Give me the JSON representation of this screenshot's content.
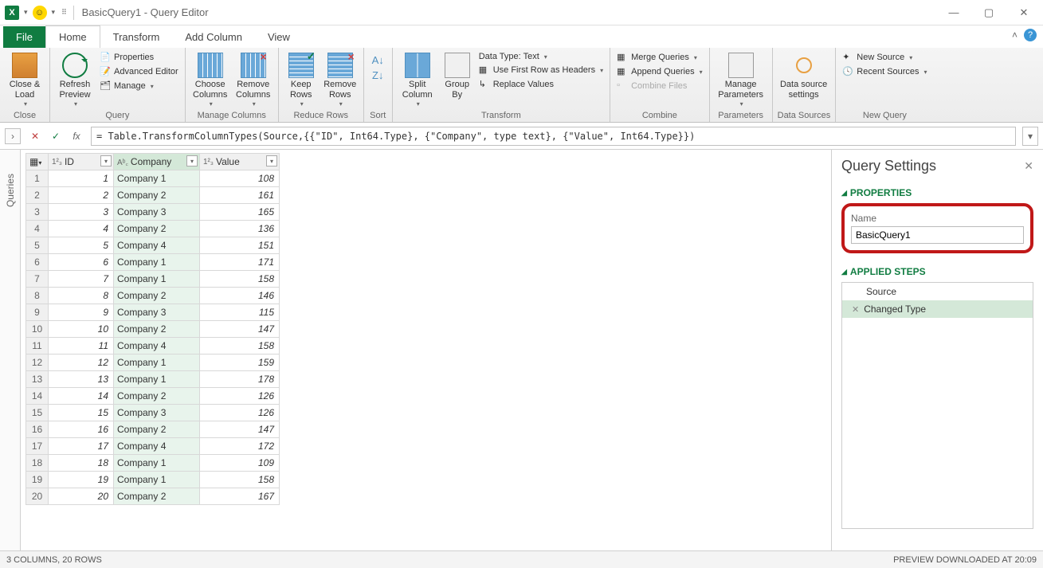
{
  "window": {
    "title": "BasicQuery1 - Query Editor"
  },
  "tabs": {
    "file": "File",
    "home": "Home",
    "transform": "Transform",
    "addcolumn": "Add Column",
    "view": "View"
  },
  "ribbon": {
    "close": {
      "big": "Close & Load",
      "group": "Close"
    },
    "query": {
      "refresh": "Refresh Preview",
      "properties": "Properties",
      "advanced": "Advanced Editor",
      "manage": "Manage",
      "group": "Query"
    },
    "managecols": {
      "choose": "Choose Columns",
      "remove": "Remove Columns",
      "group": "Manage Columns"
    },
    "reducerows": {
      "keep": "Keep Rows",
      "remove": "Remove Rows",
      "group": "Reduce Rows"
    },
    "sort": {
      "group": "Sort"
    },
    "transform": {
      "split": "Split Column",
      "groupby": "Group By",
      "datatype": "Data Type: Text",
      "firstrow": "Use First Row as Headers",
      "replace": "Replace Values",
      "group": "Transform"
    },
    "combine": {
      "merge": "Merge Queries",
      "append": "Append Queries",
      "files": "Combine Files",
      "group": "Combine"
    },
    "params": {
      "manage": "Manage Parameters",
      "group": "Parameters"
    },
    "datasrc": {
      "settings": "Data source settings",
      "group": "Data Sources"
    },
    "newquery": {
      "new": "New Source",
      "recent": "Recent Sources",
      "group": "New Query"
    }
  },
  "formula": "= Table.TransformColumnTypes(Source,{{\"ID\", Int64.Type}, {\"Company\", type text}, {\"Value\", Int64.Type}})",
  "queries_label": "Queries",
  "columns": {
    "id": "ID",
    "company": "Company",
    "value": "Value"
  },
  "rows": [
    {
      "n": 1,
      "id": 1,
      "company": "Company 1",
      "value": 108
    },
    {
      "n": 2,
      "id": 2,
      "company": "Company 2",
      "value": 161
    },
    {
      "n": 3,
      "id": 3,
      "company": "Company 3",
      "value": 165
    },
    {
      "n": 4,
      "id": 4,
      "company": "Company 2",
      "value": 136
    },
    {
      "n": 5,
      "id": 5,
      "company": "Company 4",
      "value": 151
    },
    {
      "n": 6,
      "id": 6,
      "company": "Company 1",
      "value": 171
    },
    {
      "n": 7,
      "id": 7,
      "company": "Company 1",
      "value": 158
    },
    {
      "n": 8,
      "id": 8,
      "company": "Company 2",
      "value": 146
    },
    {
      "n": 9,
      "id": 9,
      "company": "Company 3",
      "value": 115
    },
    {
      "n": 10,
      "id": 10,
      "company": "Company 2",
      "value": 147
    },
    {
      "n": 11,
      "id": 11,
      "company": "Company 4",
      "value": 158
    },
    {
      "n": 12,
      "id": 12,
      "company": "Company 1",
      "value": 159
    },
    {
      "n": 13,
      "id": 13,
      "company": "Company 1",
      "value": 178
    },
    {
      "n": 14,
      "id": 14,
      "company": "Company 2",
      "value": 126
    },
    {
      "n": 15,
      "id": 15,
      "company": "Company 3",
      "value": 126
    },
    {
      "n": 16,
      "id": 16,
      "company": "Company 2",
      "value": 147
    },
    {
      "n": 17,
      "id": 17,
      "company": "Company 4",
      "value": 172
    },
    {
      "n": 18,
      "id": 18,
      "company": "Company 1",
      "value": 109
    },
    {
      "n": 19,
      "id": 19,
      "company": "Company 1",
      "value": 158
    },
    {
      "n": 20,
      "id": 20,
      "company": "Company 2",
      "value": 167
    }
  ],
  "settings": {
    "title": "Query Settings",
    "properties": "PROPERTIES",
    "name_label": "Name",
    "name_value": "BasicQuery1",
    "applied": "APPLIED STEPS",
    "steps": {
      "source": "Source",
      "changed": "Changed Type"
    }
  },
  "status": {
    "left": "3 COLUMNS, 20 ROWS",
    "right": "PREVIEW DOWNLOADED AT 20:09"
  }
}
